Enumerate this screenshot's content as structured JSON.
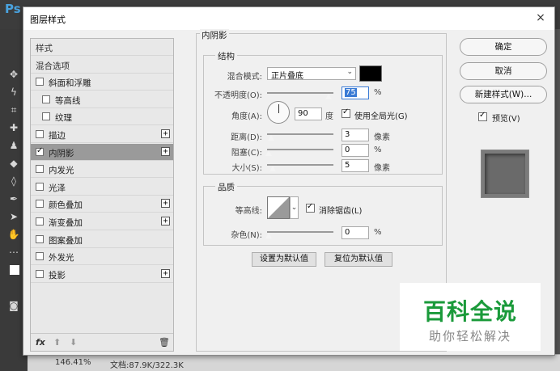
{
  "app": {
    "logo_text": "Ps"
  },
  "status_bar": {
    "zoom": "146.41%",
    "doc_info": "文档:87.9K/322.3K"
  },
  "dialog": {
    "title": "图层样式",
    "close_glyph": "×",
    "styles_list": {
      "items": [
        {
          "label": "样式",
          "type": "header"
        },
        {
          "label": "混合选项",
          "type": "header"
        },
        {
          "label": "斜面和浮雕",
          "checked": false
        },
        {
          "label": "等高线",
          "checked": false,
          "indent": true
        },
        {
          "label": "纹理",
          "checked": false,
          "indent": true
        },
        {
          "label": "描边",
          "checked": false,
          "has_add": true
        },
        {
          "label": "内阴影",
          "checked": true,
          "has_add": true,
          "selected": true
        },
        {
          "label": "内发光",
          "checked": false
        },
        {
          "label": "光泽",
          "checked": false
        },
        {
          "label": "颜色叠加",
          "checked": false,
          "has_add": true
        },
        {
          "label": "渐变叠加",
          "checked": false,
          "has_add": true
        },
        {
          "label": "图案叠加",
          "checked": false
        },
        {
          "label": "外发光",
          "checked": false
        },
        {
          "label": "投影",
          "checked": false,
          "has_add": true
        }
      ],
      "add_glyph": "+",
      "fx_label": "fx",
      "move_up_glyph": "⬆",
      "move_down_glyph": "⬇",
      "delete_glyph": "🗑"
    },
    "panel": {
      "title": "内阴影",
      "structure": {
        "legend": "结构",
        "blend_mode_label": "混合模式:",
        "blend_mode_value": "正片叠底",
        "shadow_color": "#000000",
        "opacity_label": "不透明度(O):",
        "opacity_value": "75",
        "opacity_unit": "%",
        "angle_label": "角度(A):",
        "angle_value": "90",
        "angle_unit": "度",
        "global_light_label": "使用全局光(G)",
        "global_light_checked": true,
        "distance_label": "距离(D):",
        "distance_value": "3",
        "distance_unit": "像素",
        "choke_label": "阻塞(C):",
        "choke_value": "0",
        "choke_unit": "%",
        "size_label": "大小(S):",
        "size_value": "5",
        "size_unit": "像素"
      },
      "quality": {
        "legend": "品质",
        "contour_label": "等高线:",
        "antialias_label": "消除锯齿(L)",
        "antialias_checked": true,
        "noise_label": "杂色(N):",
        "noise_value": "0",
        "noise_unit": "%"
      },
      "make_default_label": "设置为默认值",
      "reset_default_label": "复位为默认值"
    },
    "ok_label": "确定",
    "cancel_label": "取消",
    "new_style_label": "新建样式(W)...",
    "preview_label": "预览(V)",
    "preview_checked": true
  },
  "watermark": {
    "main": "百科全说",
    "sub": "助你轻松解决",
    "color": "#1a9a3a"
  }
}
